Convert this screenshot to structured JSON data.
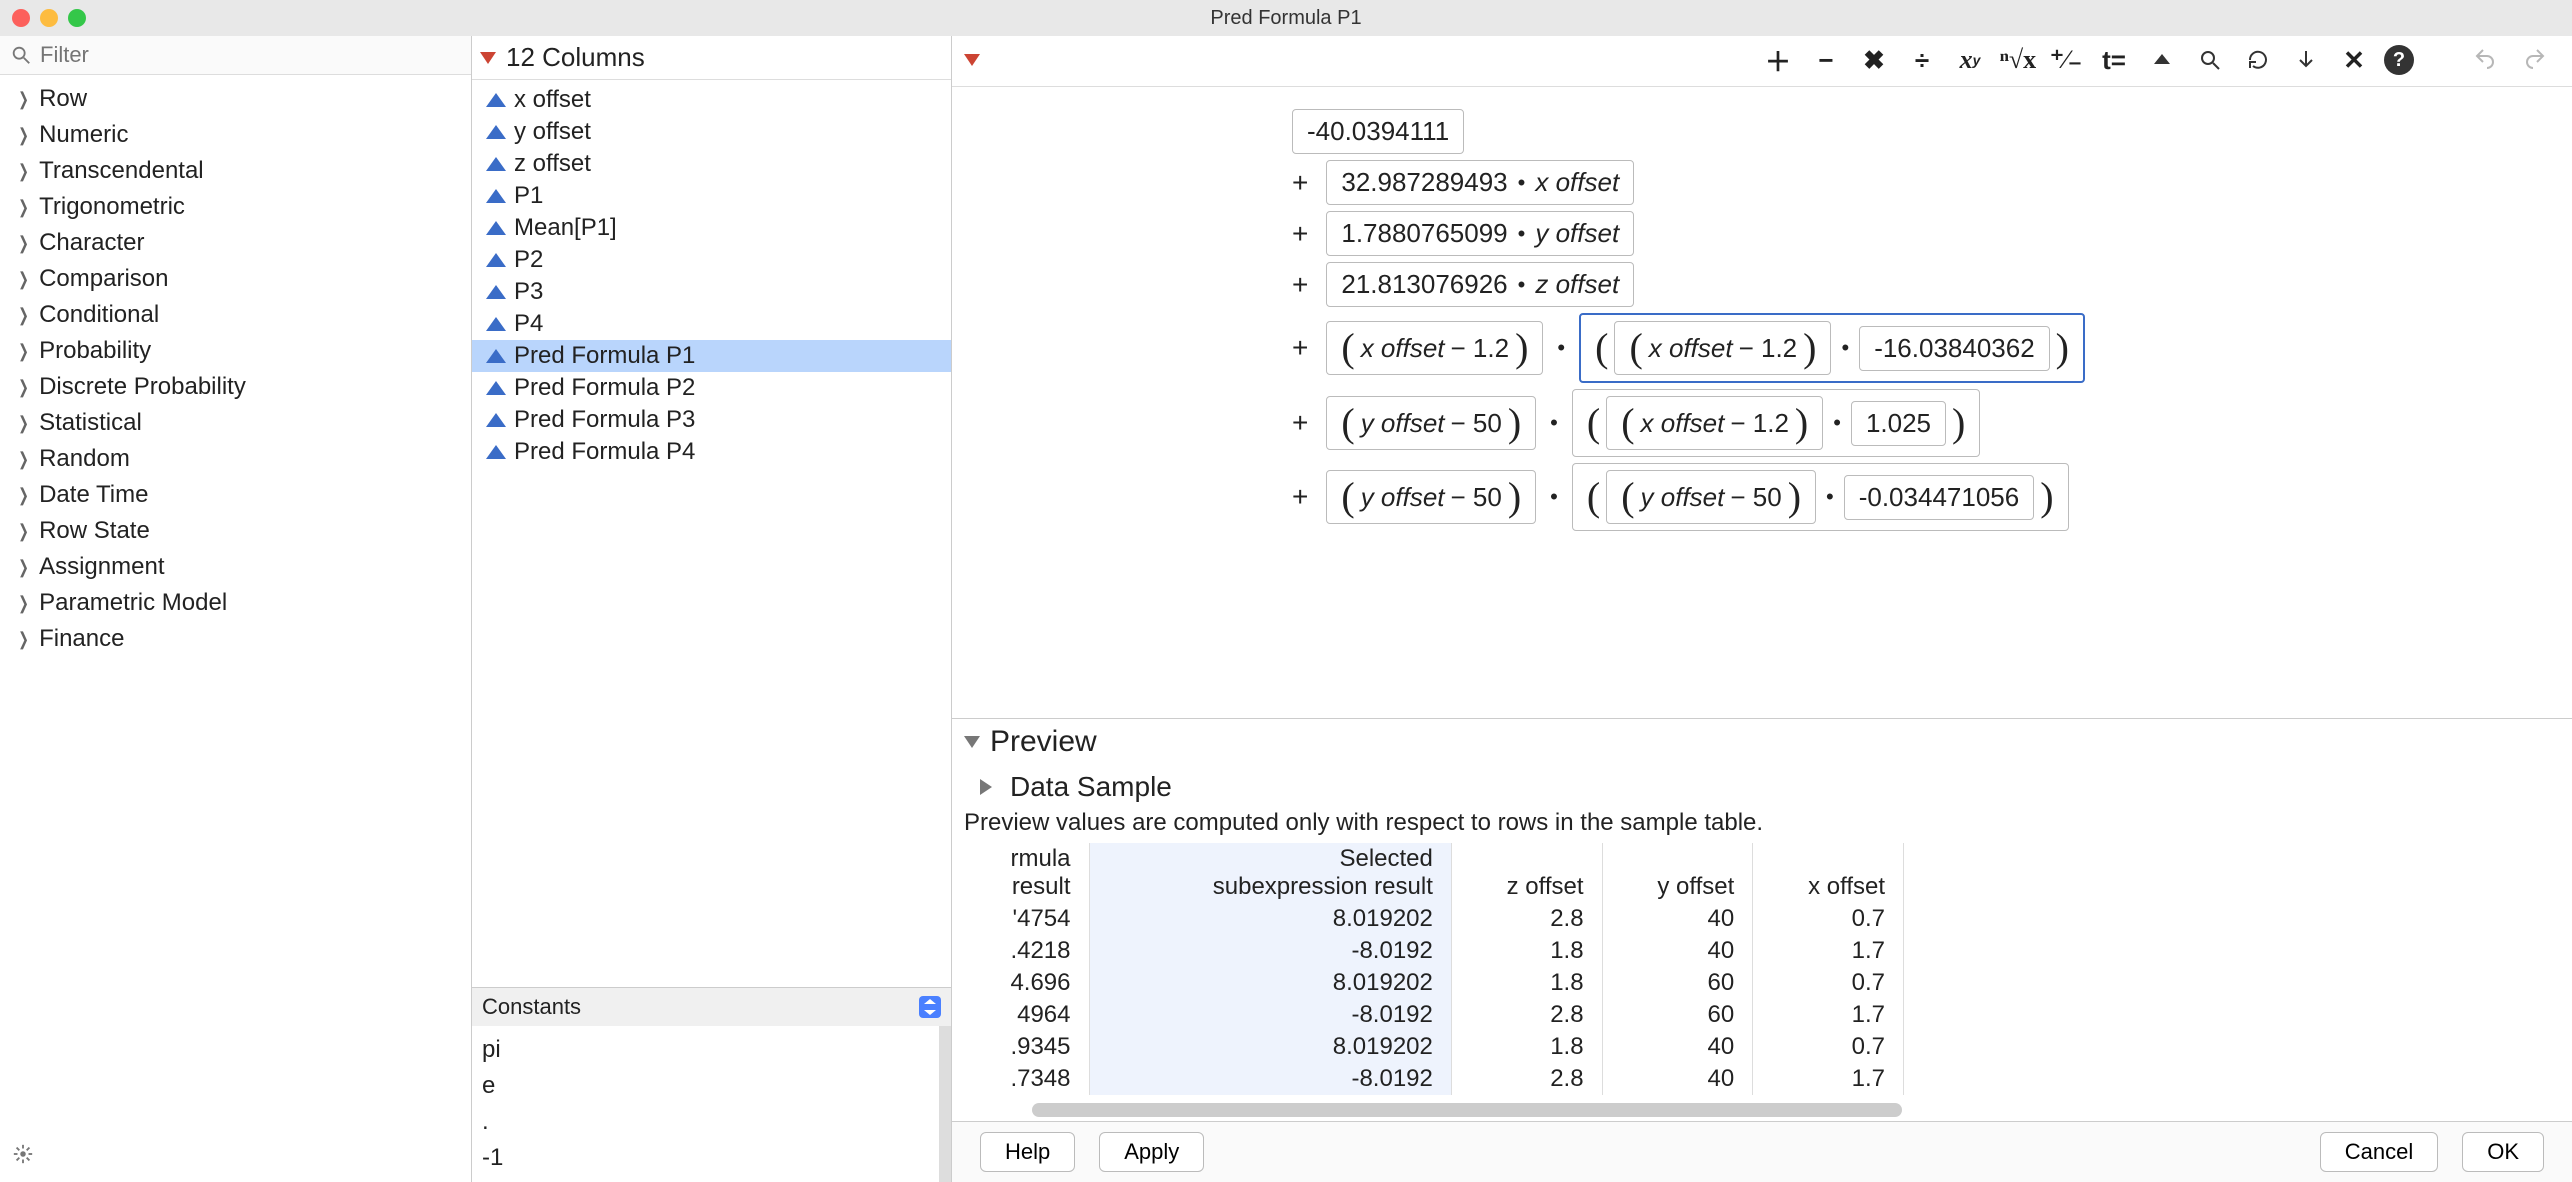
{
  "window": {
    "title": "Pred Formula P1"
  },
  "search": {
    "placeholder": "Filter"
  },
  "categories": [
    "Row",
    "Numeric",
    "Transcendental",
    "Trigonometric",
    "Character",
    "Comparison",
    "Conditional",
    "Probability",
    "Discrete Probability",
    "Statistical",
    "Random",
    "Date Time",
    "Row State",
    "Assignment",
    "Parametric Model",
    "Finance"
  ],
  "columns": {
    "header": "12 Columns",
    "items": [
      {
        "name": "x offset",
        "sel": false
      },
      {
        "name": "y offset",
        "sel": false
      },
      {
        "name": "z offset",
        "sel": false
      },
      {
        "name": "P1",
        "sel": false
      },
      {
        "name": "Mean[P1]",
        "sel": false
      },
      {
        "name": "P2",
        "sel": false
      },
      {
        "name": "P3",
        "sel": false
      },
      {
        "name": "P4",
        "sel": false
      },
      {
        "name": "Pred Formula P1",
        "sel": true
      },
      {
        "name": "Pred Formula P2",
        "sel": false
      },
      {
        "name": "Pred Formula P3",
        "sel": false
      },
      {
        "name": "Pred Formula P4",
        "sel": false
      }
    ]
  },
  "constants": {
    "header": "Constants",
    "items": [
      "pi",
      "e",
      ".",
      "-1"
    ]
  },
  "formula": {
    "const": "-40.0394111",
    "lin": [
      {
        "coef": "32.987289493",
        "var": "x offset"
      },
      {
        "coef": "1.7880765099",
        "var": "y offset"
      },
      {
        "coef": "21.813076926",
        "var": "z offset"
      }
    ],
    "quad": [
      {
        "a_var": "x offset",
        "a_off": "1.2",
        "b_var": "x offset",
        "b_off": "1.2",
        "coef": "-16.03840362",
        "hl": true
      },
      {
        "a_var": "y offset",
        "a_off": "50",
        "b_var": "x offset",
        "b_off": "1.2",
        "coef": "1.025",
        "hl": false
      },
      {
        "a_var": "y offset",
        "a_off": "50",
        "b_var": "y offset",
        "b_off": "50",
        "coef": "-0.034471056",
        "hl": false
      }
    ]
  },
  "preview": {
    "title": "Preview",
    "ds_title": "Data Sample",
    "note": "Preview values are computed only with respect to rows in the sample table.",
    "headers": {
      "c1a": "rmula",
      "c1b": "result",
      "c2a": "Selected",
      "c2b": "subexpression result",
      "c3": "z offset",
      "c4": "y offset",
      "c5": "x offset"
    },
    "rows": [
      {
        "c1": "'4754",
        "c2": "8.019202",
        "c3": "2.8",
        "c4": "40",
        "c5": "0.7"
      },
      {
        "c1": ".4218",
        "c2": "-8.0192",
        "c3": "1.8",
        "c4": "40",
        "c5": "1.7"
      },
      {
        "c1": "4.696",
        "c2": "8.019202",
        "c3": "1.8",
        "c4": "60",
        "c5": "0.7"
      },
      {
        "c1": "4964",
        "c2": "-8.0192",
        "c3": "2.8",
        "c4": "60",
        "c5": "1.7"
      },
      {
        "c1": ".9345",
        "c2": "8.019202",
        "c3": "1.8",
        "c4": "40",
        "c5": "0.7"
      },
      {
        "c1": ".7348",
        "c2": "-8.0192",
        "c3": "2.8",
        "c4": "40",
        "c5": "1.7"
      }
    ]
  },
  "buttons": {
    "help": "Help",
    "apply": "Apply",
    "cancel": "Cancel",
    "ok": "OK"
  }
}
